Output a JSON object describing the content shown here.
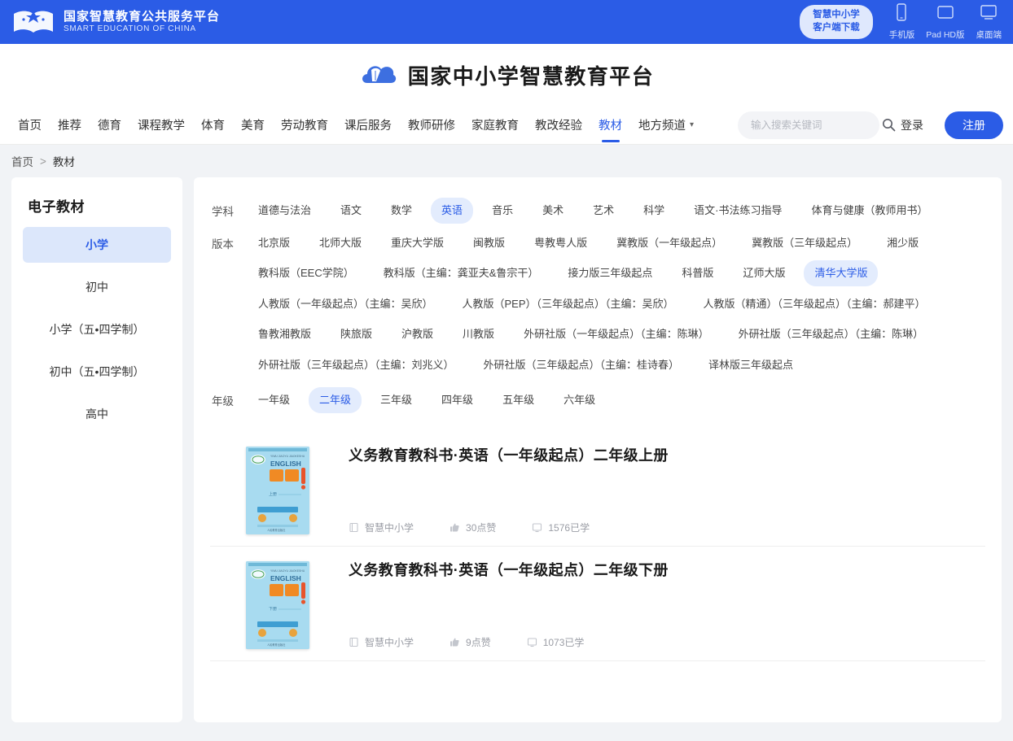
{
  "topbar": {
    "logo_cn": "国家智慧教育公共服务平台",
    "logo_en": "SMART EDUCATION OF CHINA",
    "client_download_line1": "智慧中小学",
    "client_download_line2": "客户端下载",
    "platforms": [
      {
        "icon": "phone-icon",
        "label": "手机版"
      },
      {
        "icon": "tablet-icon",
        "label": "Pad HD版"
      },
      {
        "icon": "desktop-icon",
        "label": "桌面端"
      }
    ],
    "accent": "#2b5ce6"
  },
  "header": {
    "brand_title": "国家中小学智慧教育平台"
  },
  "nav": {
    "items": [
      {
        "label": "首页",
        "active": false
      },
      {
        "label": "推荐",
        "active": false
      },
      {
        "label": "德育",
        "active": false
      },
      {
        "label": "课程教学",
        "active": false
      },
      {
        "label": "体育",
        "active": false
      },
      {
        "label": "美育",
        "active": false
      },
      {
        "label": "劳动教育",
        "active": false
      },
      {
        "label": "课后服务",
        "active": false
      },
      {
        "label": "教师研修",
        "active": false
      },
      {
        "label": "家庭教育",
        "active": false
      },
      {
        "label": "教改经验",
        "active": false
      },
      {
        "label": "教材",
        "active": true
      },
      {
        "label": "地方频道",
        "active": false,
        "caret": true
      }
    ],
    "search_placeholder": "输入搜索关键词",
    "search_value": "",
    "login_label": "登录",
    "register_label": "注册"
  },
  "breadcrumb": {
    "home": "首页",
    "separator": ">",
    "current": "教材"
  },
  "sidebar": {
    "title": "电子教材",
    "items": [
      {
        "label": "小学",
        "active": true
      },
      {
        "label": "初中",
        "active": false
      },
      {
        "label": "小学（五•四学制）",
        "active": false
      },
      {
        "label": "初中（五•四学制）",
        "active": false
      },
      {
        "label": "高中",
        "active": false
      }
    ]
  },
  "filters": [
    {
      "label": "学科",
      "name": "subject",
      "options": [
        {
          "label": "道德与法治",
          "active": false
        },
        {
          "label": "语文",
          "active": false
        },
        {
          "label": "数学",
          "active": false
        },
        {
          "label": "英语",
          "active": true
        },
        {
          "label": "音乐",
          "active": false
        },
        {
          "label": "美术",
          "active": false
        },
        {
          "label": "艺术",
          "active": false
        },
        {
          "label": "科学",
          "active": false
        },
        {
          "label": "语文·书法练习指导",
          "active": false
        },
        {
          "label": "体育与健康（教师用书）",
          "active": false
        }
      ]
    },
    {
      "label": "版本",
      "name": "edition",
      "options": [
        {
          "label": "北京版",
          "active": false
        },
        {
          "label": "北师大版",
          "active": false
        },
        {
          "label": "重庆大学版",
          "active": false
        },
        {
          "label": "闽教版",
          "active": false
        },
        {
          "label": "粤教粤人版",
          "active": false
        },
        {
          "label": "冀教版（一年级起点）",
          "active": false
        },
        {
          "label": "冀教版（三年级起点）",
          "active": false
        },
        {
          "label": "湘少版",
          "active": false
        },
        {
          "label": "教科版（EEC学院）",
          "active": false
        },
        {
          "label": "教科版（主编：龚亚夫&鲁宗干）",
          "active": false
        },
        {
          "label": "接力版三年级起点",
          "active": false
        },
        {
          "label": "科普版",
          "active": false
        },
        {
          "label": "辽师大版",
          "active": false
        },
        {
          "label": "清华大学版",
          "active": true
        },
        {
          "label": "人教版（一年级起点）（主编：吴欣）",
          "active": false
        },
        {
          "label": "人教版（PEP）（三年级起点）（主编：吴欣）",
          "active": false
        },
        {
          "label": "人教版（精通）（三年级起点）（主编：郝建平）",
          "active": false
        },
        {
          "label": "鲁教湘教版",
          "active": false
        },
        {
          "label": "陕旅版",
          "active": false
        },
        {
          "label": "沪教版",
          "active": false
        },
        {
          "label": "川教版",
          "active": false
        },
        {
          "label": "外研社版（一年级起点）（主编：陈琳）",
          "active": false
        },
        {
          "label": "外研社版（三年级起点）（主编：陈琳）",
          "active": false
        },
        {
          "label": "外研社版（三年级起点）（主编：刘兆义）",
          "active": false
        },
        {
          "label": "外研社版（三年级起点）（主编：桂诗春）",
          "active": false
        },
        {
          "label": "译林版三年级起点",
          "active": false
        }
      ]
    },
    {
      "label": "年级",
      "name": "grade",
      "options": [
        {
          "label": "一年级",
          "active": false
        },
        {
          "label": "二年级",
          "active": true
        },
        {
          "label": "三年级",
          "active": false
        },
        {
          "label": "四年级",
          "active": false
        },
        {
          "label": "五年级",
          "active": false
        },
        {
          "label": "六年级",
          "active": false
        }
      ]
    }
  ],
  "books": [
    {
      "title": "义务教育教科书·英语（一年级起点）二年级上册",
      "publisher": "智慧中小学",
      "likes": "30点赞",
      "studied": "1576已学",
      "cover": {
        "bg": "#a8dbf0",
        "title_en": "ENGLISH",
        "title_cn": "英语",
        "term": "上册"
      }
    },
    {
      "title": "义务教育教科书·英语（一年级起点）二年级下册",
      "publisher": "智慧中小学",
      "likes": "9点赞",
      "studied": "1073已学",
      "cover": {
        "bg": "#a8dbf0",
        "title_en": "ENGLISH",
        "title_cn": "英语",
        "term": "下册"
      }
    }
  ]
}
